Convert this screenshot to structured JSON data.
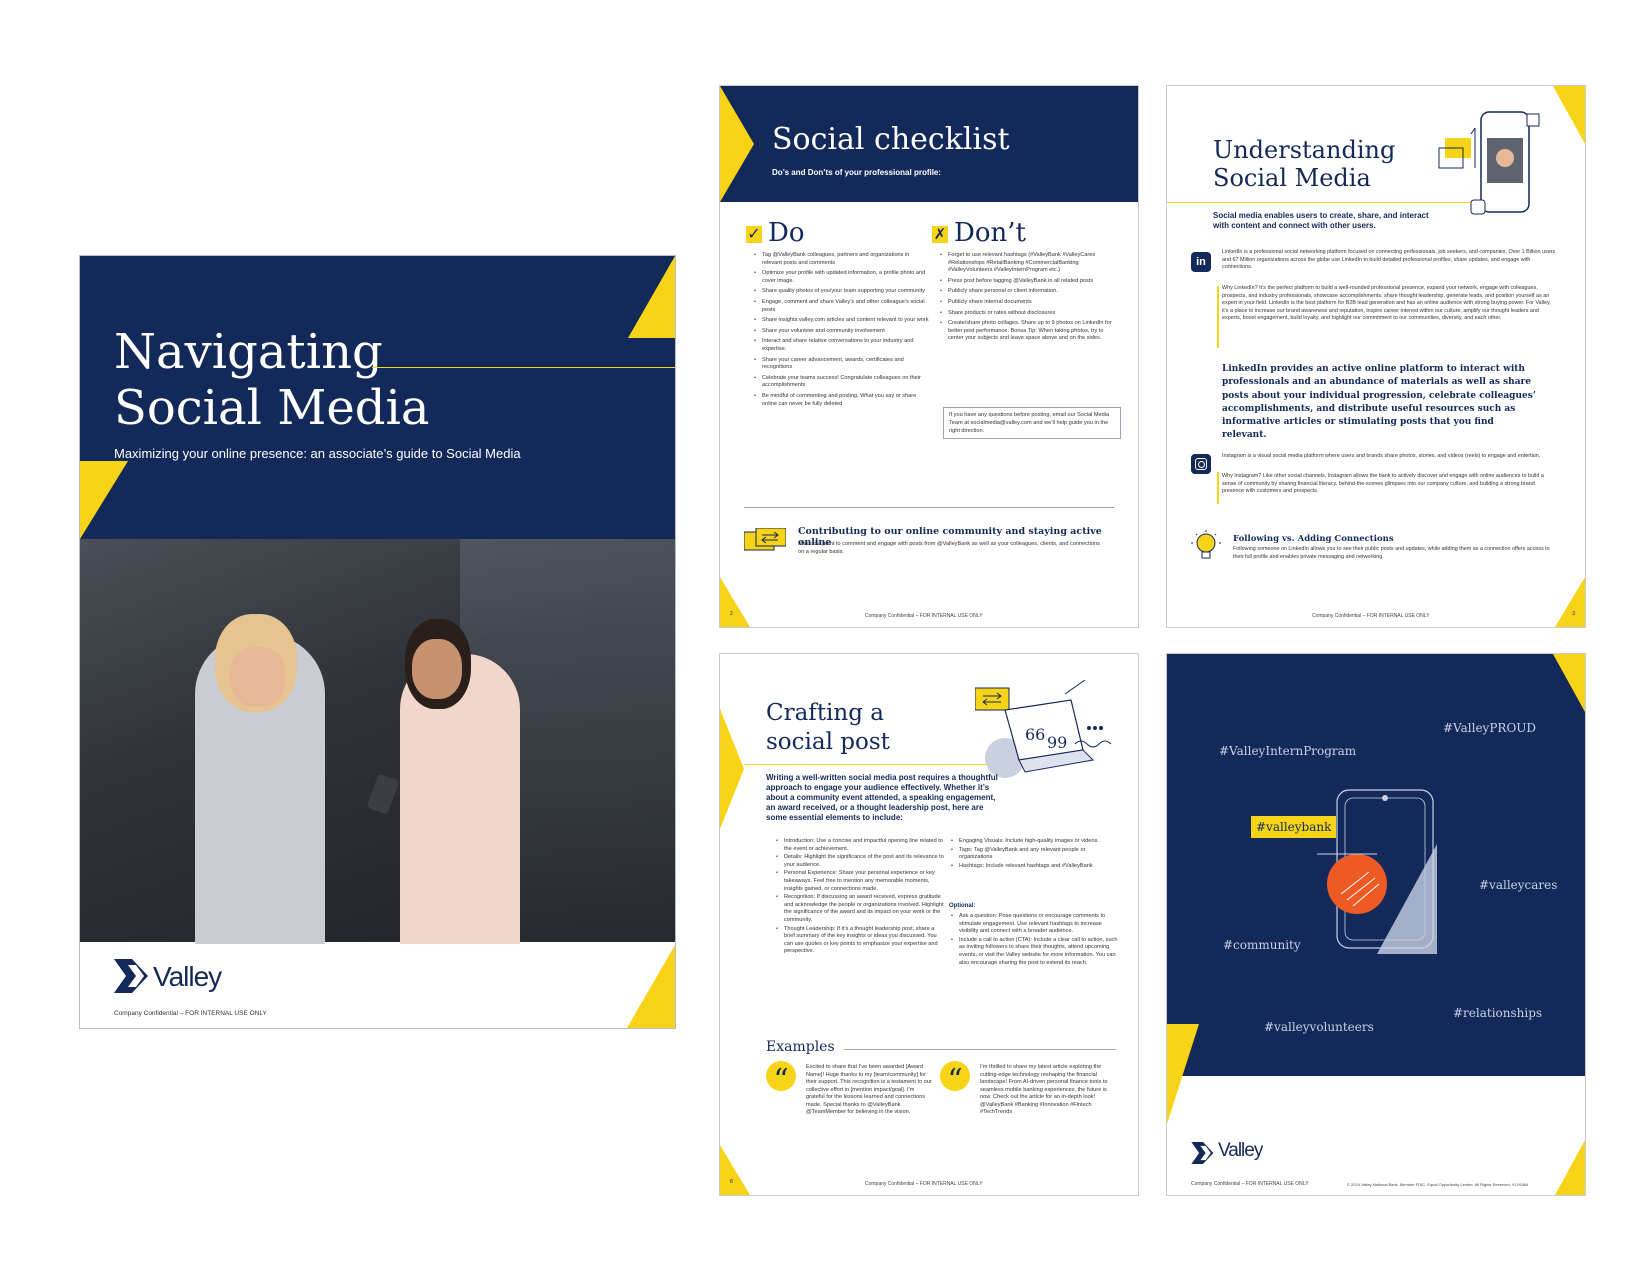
{
  "cover": {
    "title_line1": "Navigating",
    "title_line2": "Social Media",
    "subtitle": "Maximizing your online presence: an associate’s guide to Social Media",
    "brand": "Valley",
    "footer": "Company Confidential – FOR INTERNAL USE ONLY"
  },
  "checklist": {
    "title": "Social checklist",
    "subtitle": "Do’s and Don’ts of your professional profile:",
    "do_heading": "Do",
    "dont_heading": "Don’t",
    "do_items": [
      "Tag @ValleyBank colleagues, partners and organizations in relevant posts and comments",
      "Optimize your profile with updated information, a profile photo and cover image.",
      "Share quality photos of you/your team supporting your community",
      "Engage, comment and share Valley’s and other colleague’s social posts",
      "Share insights.valley.com articles and content relevant to your work",
      "Share your volunteer and community involvement",
      "Interact and share relative conversations to your industry and expertise.",
      "Share your career advancement, awards, certificates and recognitions",
      "Celebrate your teams success! Congratulate colleagues on their accomplishments",
      "Be mindful of commenting and posting. What you say or share online can never be fully deleted"
    ],
    "dont_items": [
      "Forget to use relevant hashtags (#ValleyBank #ValleyCares #Relationships #RetailBanking #CommercialBanking #ValleyVolunteers #ValleyInternProgram etc.)",
      "Press post before tagging @ValleyBank in all related posts",
      "Publicly share personal or client information.",
      "Publicly share internal documents",
      "Share products or rates without disclosures",
      "Create/share photo collages. Share up to 9 photos on LinkedIn for better post performance. Bonus Tip: When taking photos, try to center your subjects and leave space above and on the sides."
    ],
    "note": "If you have any questions before posting, email our Social Media Team at socialmedia@valley.com and we’ll help guide you in the right direction.",
    "callout_title": "Contributing to our online community and staying active online",
    "callout_text": "Make it a point to comment and engage with posts from @ValleyBank as well as your colleagues, clients, and connections on a regular basis.",
    "page_num": "2",
    "footer": "Company Confidential – FOR INTERNAL USE ONLY"
  },
  "understanding": {
    "title_line1": "Understanding",
    "title_line2": "Social Media",
    "intro": "Social media enables users to create, share, and interact with content and connect with other users.",
    "linkedin_text": "LinkedIn is a professional social networking platform focused on connecting professionals, job seekers, and companies. Over 1 Billion users and 67 Million organizations across the globe use LinkedIn to build detailed professional profiles, share updates, and engage with connections.",
    "linkedin_why": "Why LinkedIn? It’s the perfect platform to build a well-rounded professional presence, expand your network, engage with colleagues, prospects, and industry professionals, showcase accomplishments, share thought leadership, generate leads, and position yourself as an expert in your field. LinkedIn is the best platform for B2B lead generation and has an online audience with strong buying power. For Valley, it’s a place to increase our brand awareness and reputation, inspire career interest within our culture, amplify our thought leaders and experts, boost engagement, build loyalty, and highlight our commitment to our communities, diversity, and each other.",
    "quote": "LinkedIn provides an active online platform to interact with professionals and an abundance of materials as well as share posts about your individual progression, celebrate colleagues’ accomplishments, and distribute useful resources such as informative articles or stimulating posts that you find relevant.",
    "instagram_text": "Instagram is a visual social media platform where users and brands share photos, stories, and videos (reels) to engage and entertain.",
    "instagram_why": "Why Instagram? Like other social channels, Instagram allows the bank to actively discover and engage with online audiences to build a sense of community by sharing financial literacy, behind-the-scenes glimpses into our company culture, and building a strong brand presence with customers and prospects.",
    "follow_title": "Following vs. Adding Connections",
    "follow_text": "Following someone on LinkedIn allows you to see their public posts and updates, while adding them as a connection offers access to their full profile and enables private messaging and networking.",
    "page_num": "3",
    "footer": "Company Confidential – FOR INTERNAL USE ONLY"
  },
  "crafting": {
    "title_line1": "Crafting a",
    "title_line2": "social post",
    "intro": "Writing a well-written social media post requires a thoughtful approach to engage your audience effectively. Whether it’s about a community event attended, a speaking engagement, an award received, or a thought leadership post, here are some essential elements to include:",
    "left_items": [
      "Introduction: Use a concise and impactful opening line related to the event or achievement.",
      "Details: Highlight the significance of the post and its relevance to your audience.",
      "Personal Experience: Share your personal experience or key takeaways. Feel free to mention any memorable moments, insights gained, or connections made.",
      "Recognition: If discussing an award received, express gratitude and acknowledge the people or organizations involved. Highlight the significance of the award and its impact on your work or the community.",
      "Thought Leadership: If it’s a thought leadership post, share a brief summary of the key insights or ideas you discussed. You can use quotes or key points to emphasize your expertise and perspective."
    ],
    "right_items": [
      "Engaging Visuals: Include high-quality images or videos.",
      "Tags: Tag @ValleyBank and any relevant people or organizations",
      "Hashtags: Include relevant hashtags and #ValleyBank"
    ],
    "optional_label": "Optional:",
    "optional_items": [
      "Ask a question: Pose questions or encourage comments to stimulate engagement. Use relevant hashtags to increase visibility and connect with a broader audience.",
      "Include a call to action (CTA): Include a clear call to action, such as inviting followers to share their thoughts, attend upcoming events, or visit the Valley website for more information. You can also encourage sharing the post to extend its reach."
    ],
    "examples_heading": "Examples",
    "example1": "Excited to share that I’ve been awarded [Award Name]! Huge thanks to my [team/community] for their support. This recognition is a testament to our collective effort in [mention impact/goal]. I’m grateful for the lessons learned and connections made. Special thanks to @ValleyBank @TeamMember for believing in the vision.",
    "example2": "I’m thrilled to share my latest article exploring the cutting-edge technology reshaping the financial landscape! From AI-driven personal finance tools to seamless mobile banking experiences, the future is now. Check out the article for an in-depth look! @ValleyBank #Banking #Innovation #Fintech #TechTrends",
    "page_num": "8",
    "footer": "Company Confidential – FOR INTERNAL USE ONLY"
  },
  "back": {
    "hashtags": [
      "#ValleyInternProgram",
      "#ValleyPROUD",
      "#valleybank",
      "#valleycares",
      "#community",
      "#valleyvolunteers",
      "#relationships"
    ],
    "brand": "Valley",
    "footer": "Company Confidential – FOR INTERNAL USE ONLY",
    "legal": "© 2024 Valley National Bank. Member FDIC. Equal Opportunity Lender. All Rights Reserved. VLY6384"
  },
  "colors": {
    "navy": "#13295a",
    "yellow": "#f7d417",
    "orange": "#ee5a24"
  }
}
